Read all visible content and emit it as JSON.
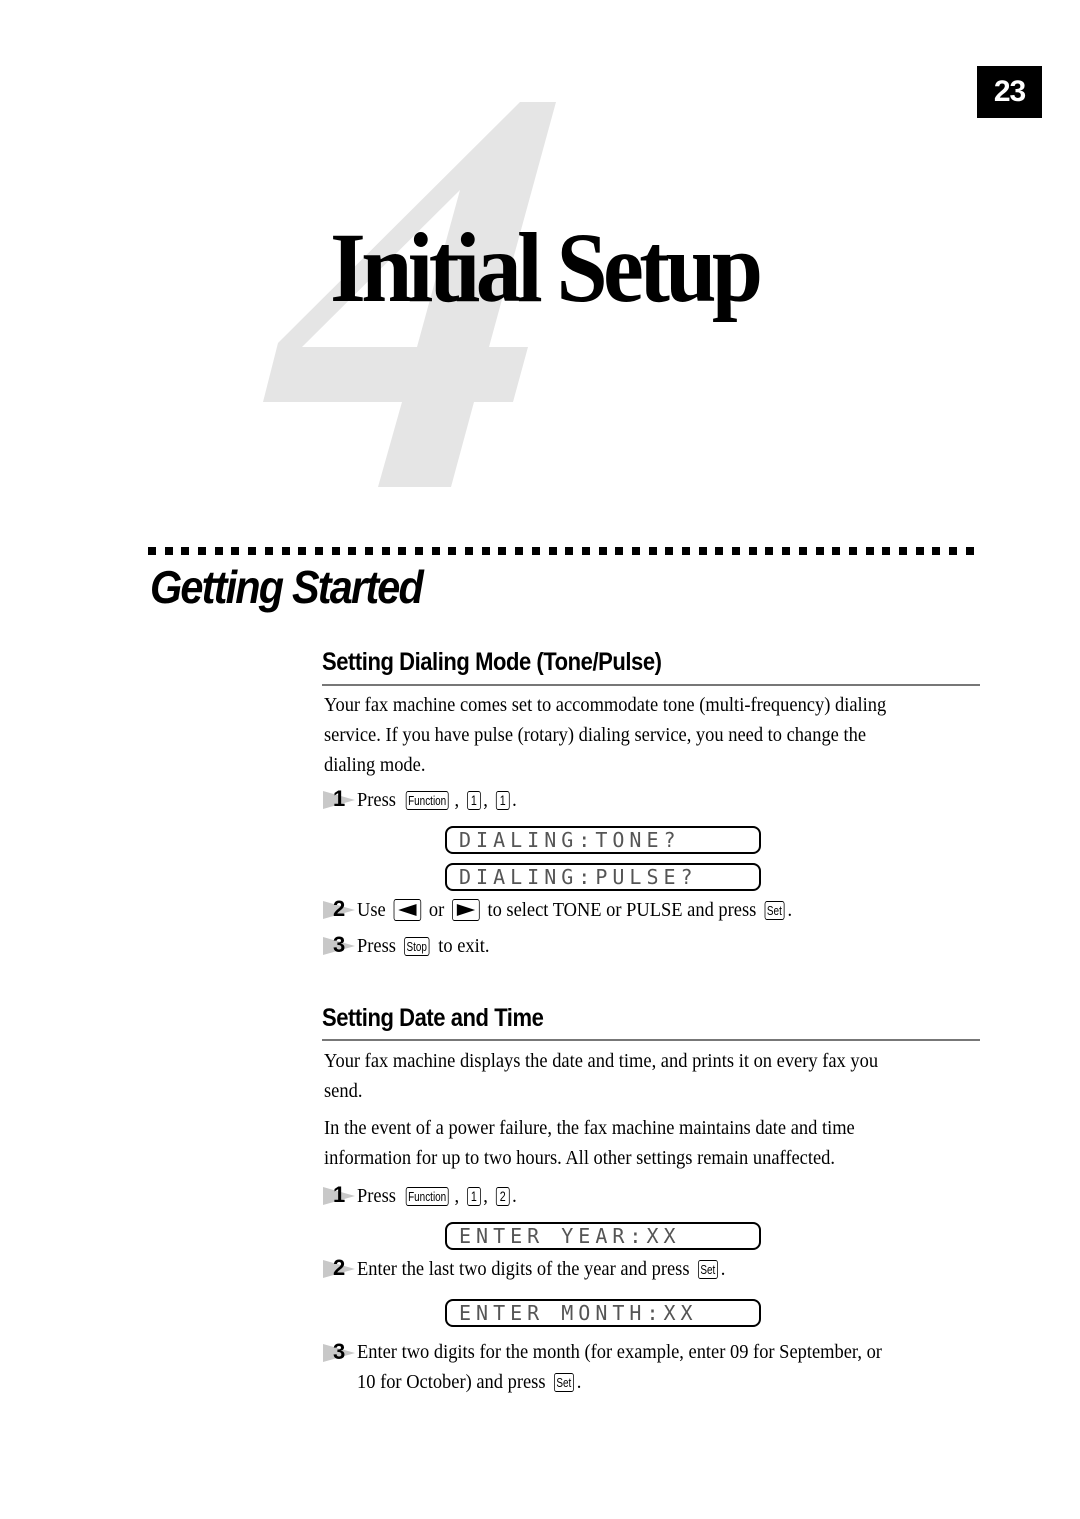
{
  "header": {
    "page_number": "23",
    "chapter_number": "4",
    "chapter_title": "Initial Setup"
  },
  "section": {
    "title": "Getting Started"
  },
  "dialing": {
    "heading": "Setting Dialing Mode (Tone/Pulse)",
    "intro_lines": [
      "Your fax machine comes set to accommodate tone (multi-frequency) dialing",
      "service. If you have pulse (rotary) dialing service, you need to change the",
      "dialing mode."
    ],
    "steps": [
      {
        "number": "1",
        "prefix": "Press",
        "keys": [
          "Function",
          "1",
          "1"
        ],
        "suffix": "."
      },
      {
        "number": "2",
        "prefix": "Use",
        "key_left": "left-arrow-key",
        "or": "or",
        "key_right": "right-arrow-key",
        "middle": "to select TONE or PULSE and press",
        "key_set": "Set",
        "suffix": "."
      },
      {
        "number": "3",
        "prefix": "Press",
        "key_stop": "Stop",
        "suffix": "to exit."
      }
    ],
    "lcd": [
      "DIALING:TONE?",
      "DIALING:PULSE?"
    ]
  },
  "datetime": {
    "heading": "Setting Date and Time",
    "para1_lines": [
      "Your fax machine displays the date and time, and prints it on every fax you",
      "send."
    ],
    "para2_lines": [
      "In the event of a power failure, the fax machine maintains date and time",
      "information for up to two hours. All other settings remain unaffected."
    ],
    "steps": [
      {
        "number": "1",
        "prefix": "Press",
        "keys": [
          "Function",
          "1",
          "2"
        ],
        "suffix": "."
      },
      {
        "number": "2",
        "text": "Enter the last two digits of the year and press",
        "key_set": "Set",
        "suffix": "."
      },
      {
        "number": "3",
        "line1": "Enter two digits for the month (for example, enter 09 for September, or",
        "line2": "10 for October) and press",
        "key_set": "Set",
        "suffix": "."
      }
    ],
    "lcd": [
      "ENTER YEAR:XX",
      "ENTER MONTH:XX"
    ]
  },
  "colors": {
    "chapter_digit": "#e5e5e5",
    "step_marker": "#c8c8c8",
    "rule": "#777777"
  }
}
